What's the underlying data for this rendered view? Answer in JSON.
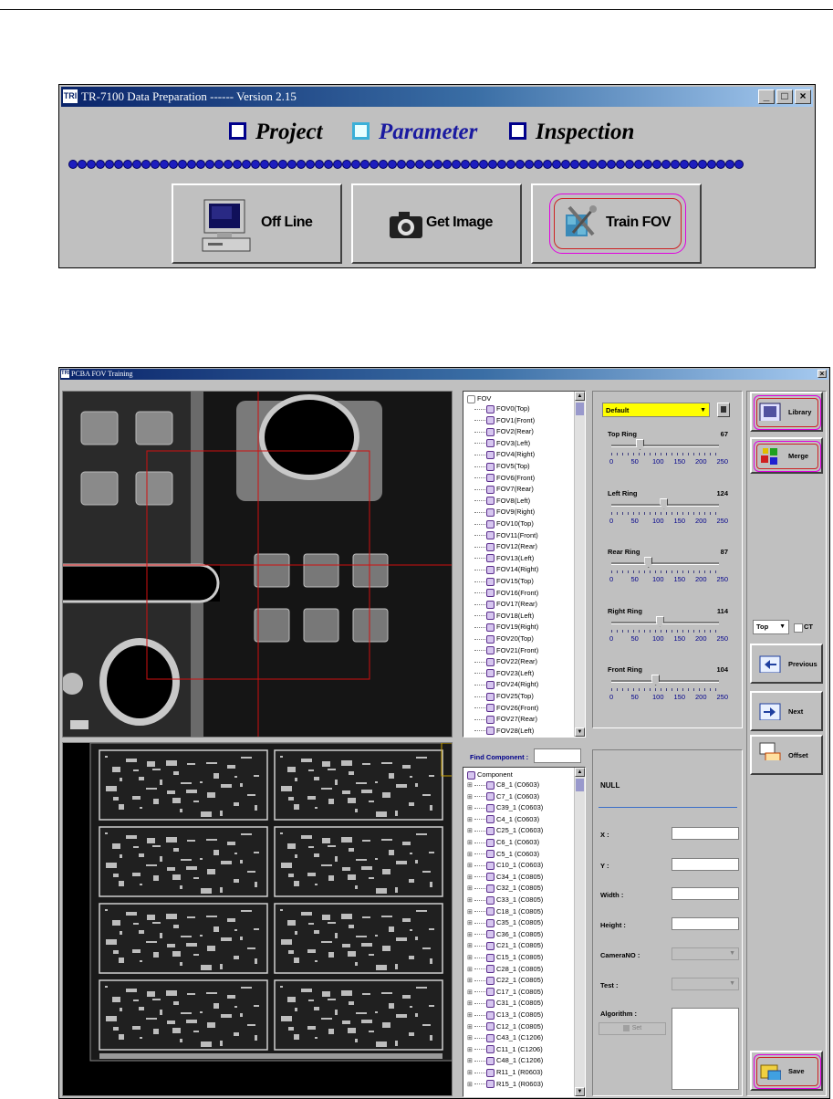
{
  "window1": {
    "title": "TR-7100 Data Preparation ------ Version 2.15",
    "logo": "TRI",
    "controls": [
      "minimize-icon",
      "maximize-icon",
      "close-icon"
    ],
    "tabs": [
      "Project",
      "Parameter",
      "Inspection"
    ],
    "buttons": [
      {
        "label": "Off Line",
        "icon": "computer-icon"
      },
      {
        "label": "Get Image",
        "icon": "camera-icon"
      },
      {
        "label": "Train FOV",
        "icon": "tools-icon"
      }
    ]
  },
  "window2": {
    "title": "PCBA FOV Training",
    "logo": "TRI",
    "fov_tree": {
      "root": "FOV",
      "items": [
        "FOV0(Top)",
        "FOV1(Front)",
        "FOV2(Rear)",
        "FOV3(Left)",
        "FOV4(Right)",
        "FOV5(Top)",
        "FOV6(Front)",
        "FOV7(Rear)",
        "FOV8(Left)",
        "FOV9(Right)",
        "FOV10(Top)",
        "FOV11(Front)",
        "FOV12(Rear)",
        "FOV13(Left)",
        "FOV14(Right)",
        "FOV15(Top)",
        "FOV16(Front)",
        "FOV17(Rear)",
        "FOV18(Left)",
        "FOV19(Right)",
        "FOV20(Top)",
        "FOV21(Front)",
        "FOV22(Rear)",
        "FOV23(Left)",
        "FOV24(Right)",
        "FOV25(Top)",
        "FOV26(Front)",
        "FOV27(Rear)",
        "FOV28(Left)"
      ]
    },
    "lighting": {
      "preset": "Default",
      "scale_labels": [
        "0",
        "50",
        "100",
        "150",
        "200",
        "250"
      ],
      "rings": [
        {
          "name": "Top Ring",
          "value": 67
        },
        {
          "name": "Left Ring",
          "value": 124
        },
        {
          "name": "Rear Ring",
          "value": 87
        },
        {
          "name": "Right Ring",
          "value": 114
        },
        {
          "name": "Front Ring",
          "value": 104
        }
      ]
    },
    "find_component_label": "Find Component :",
    "component_tree": {
      "root": "Component",
      "items": [
        "C8_1 (C0603)",
        "C7_1 (C0603)",
        "C39_1 (C0603)",
        "C4_1 (C0603)",
        "C25_1 (C0603)",
        "C6_1 (C0603)",
        "C5_1 (C0603)",
        "C10_1 (C0603)",
        "C34_1 (C0805)",
        "C32_1 (C0805)",
        "C33_1 (C0805)",
        "C18_1 (C0805)",
        "C35_1 (C0805)",
        "C36_1 (C0805)",
        "C21_1 (C0805)",
        "C15_1 (C0805)",
        "C28_1 (C0805)",
        "C22_1 (C0805)",
        "C17_1 (C0805)",
        "C31_1 (C0805)",
        "C13_1 (C0805)",
        "C12_1 (C0805)",
        "C43_1 (C1206)",
        "C11_1 (C1206)",
        "C48_1 (C1206)",
        "R11_1 (R0603)",
        "R15_1 (R0603)"
      ]
    },
    "properties": {
      "name": "NULL",
      "fields": [
        "X :",
        "Y :",
        "Width :",
        "Height :",
        "CameraNO :",
        "Test :",
        "Algorithm :"
      ],
      "set_label": "Set"
    },
    "side": {
      "library": "Library",
      "merge": "Merge",
      "view_select": "Top",
      "ct_label": "CT",
      "previous": "Previous",
      "next": "Next",
      "offset": "Offset",
      "save": "Save"
    }
  }
}
